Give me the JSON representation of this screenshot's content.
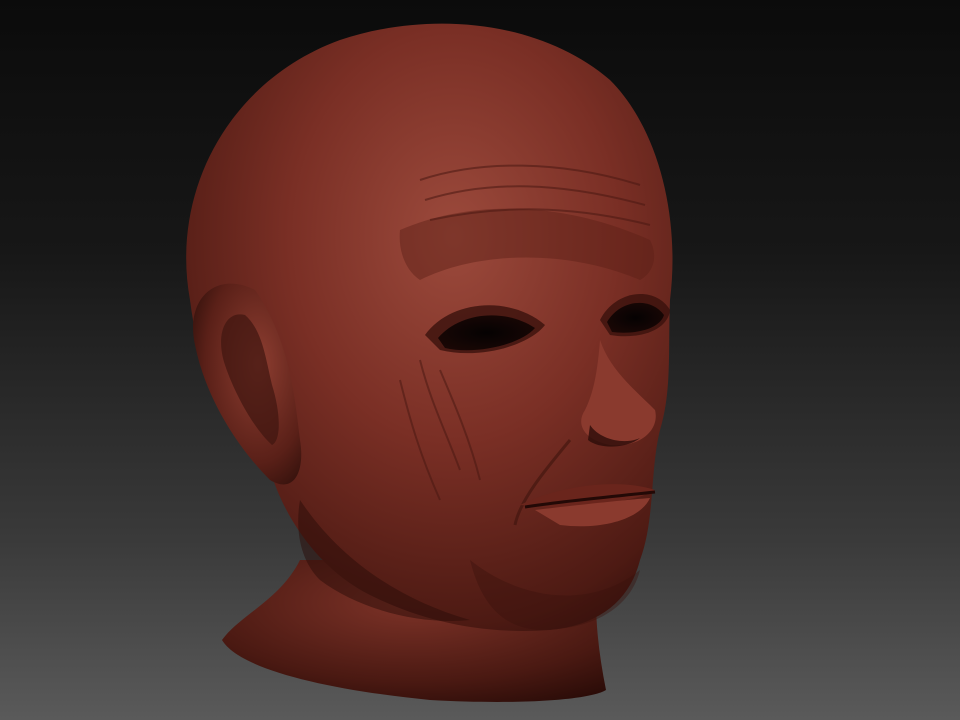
{
  "viewport": {
    "background_top": "#0b0b0b",
    "background_bottom": "#5a5a5a"
  },
  "model": {
    "subject": "head-sculpt",
    "material_color": "#7a2f25",
    "highlight_color": "#9c4a3c",
    "shadow_color": "#3a120d"
  }
}
